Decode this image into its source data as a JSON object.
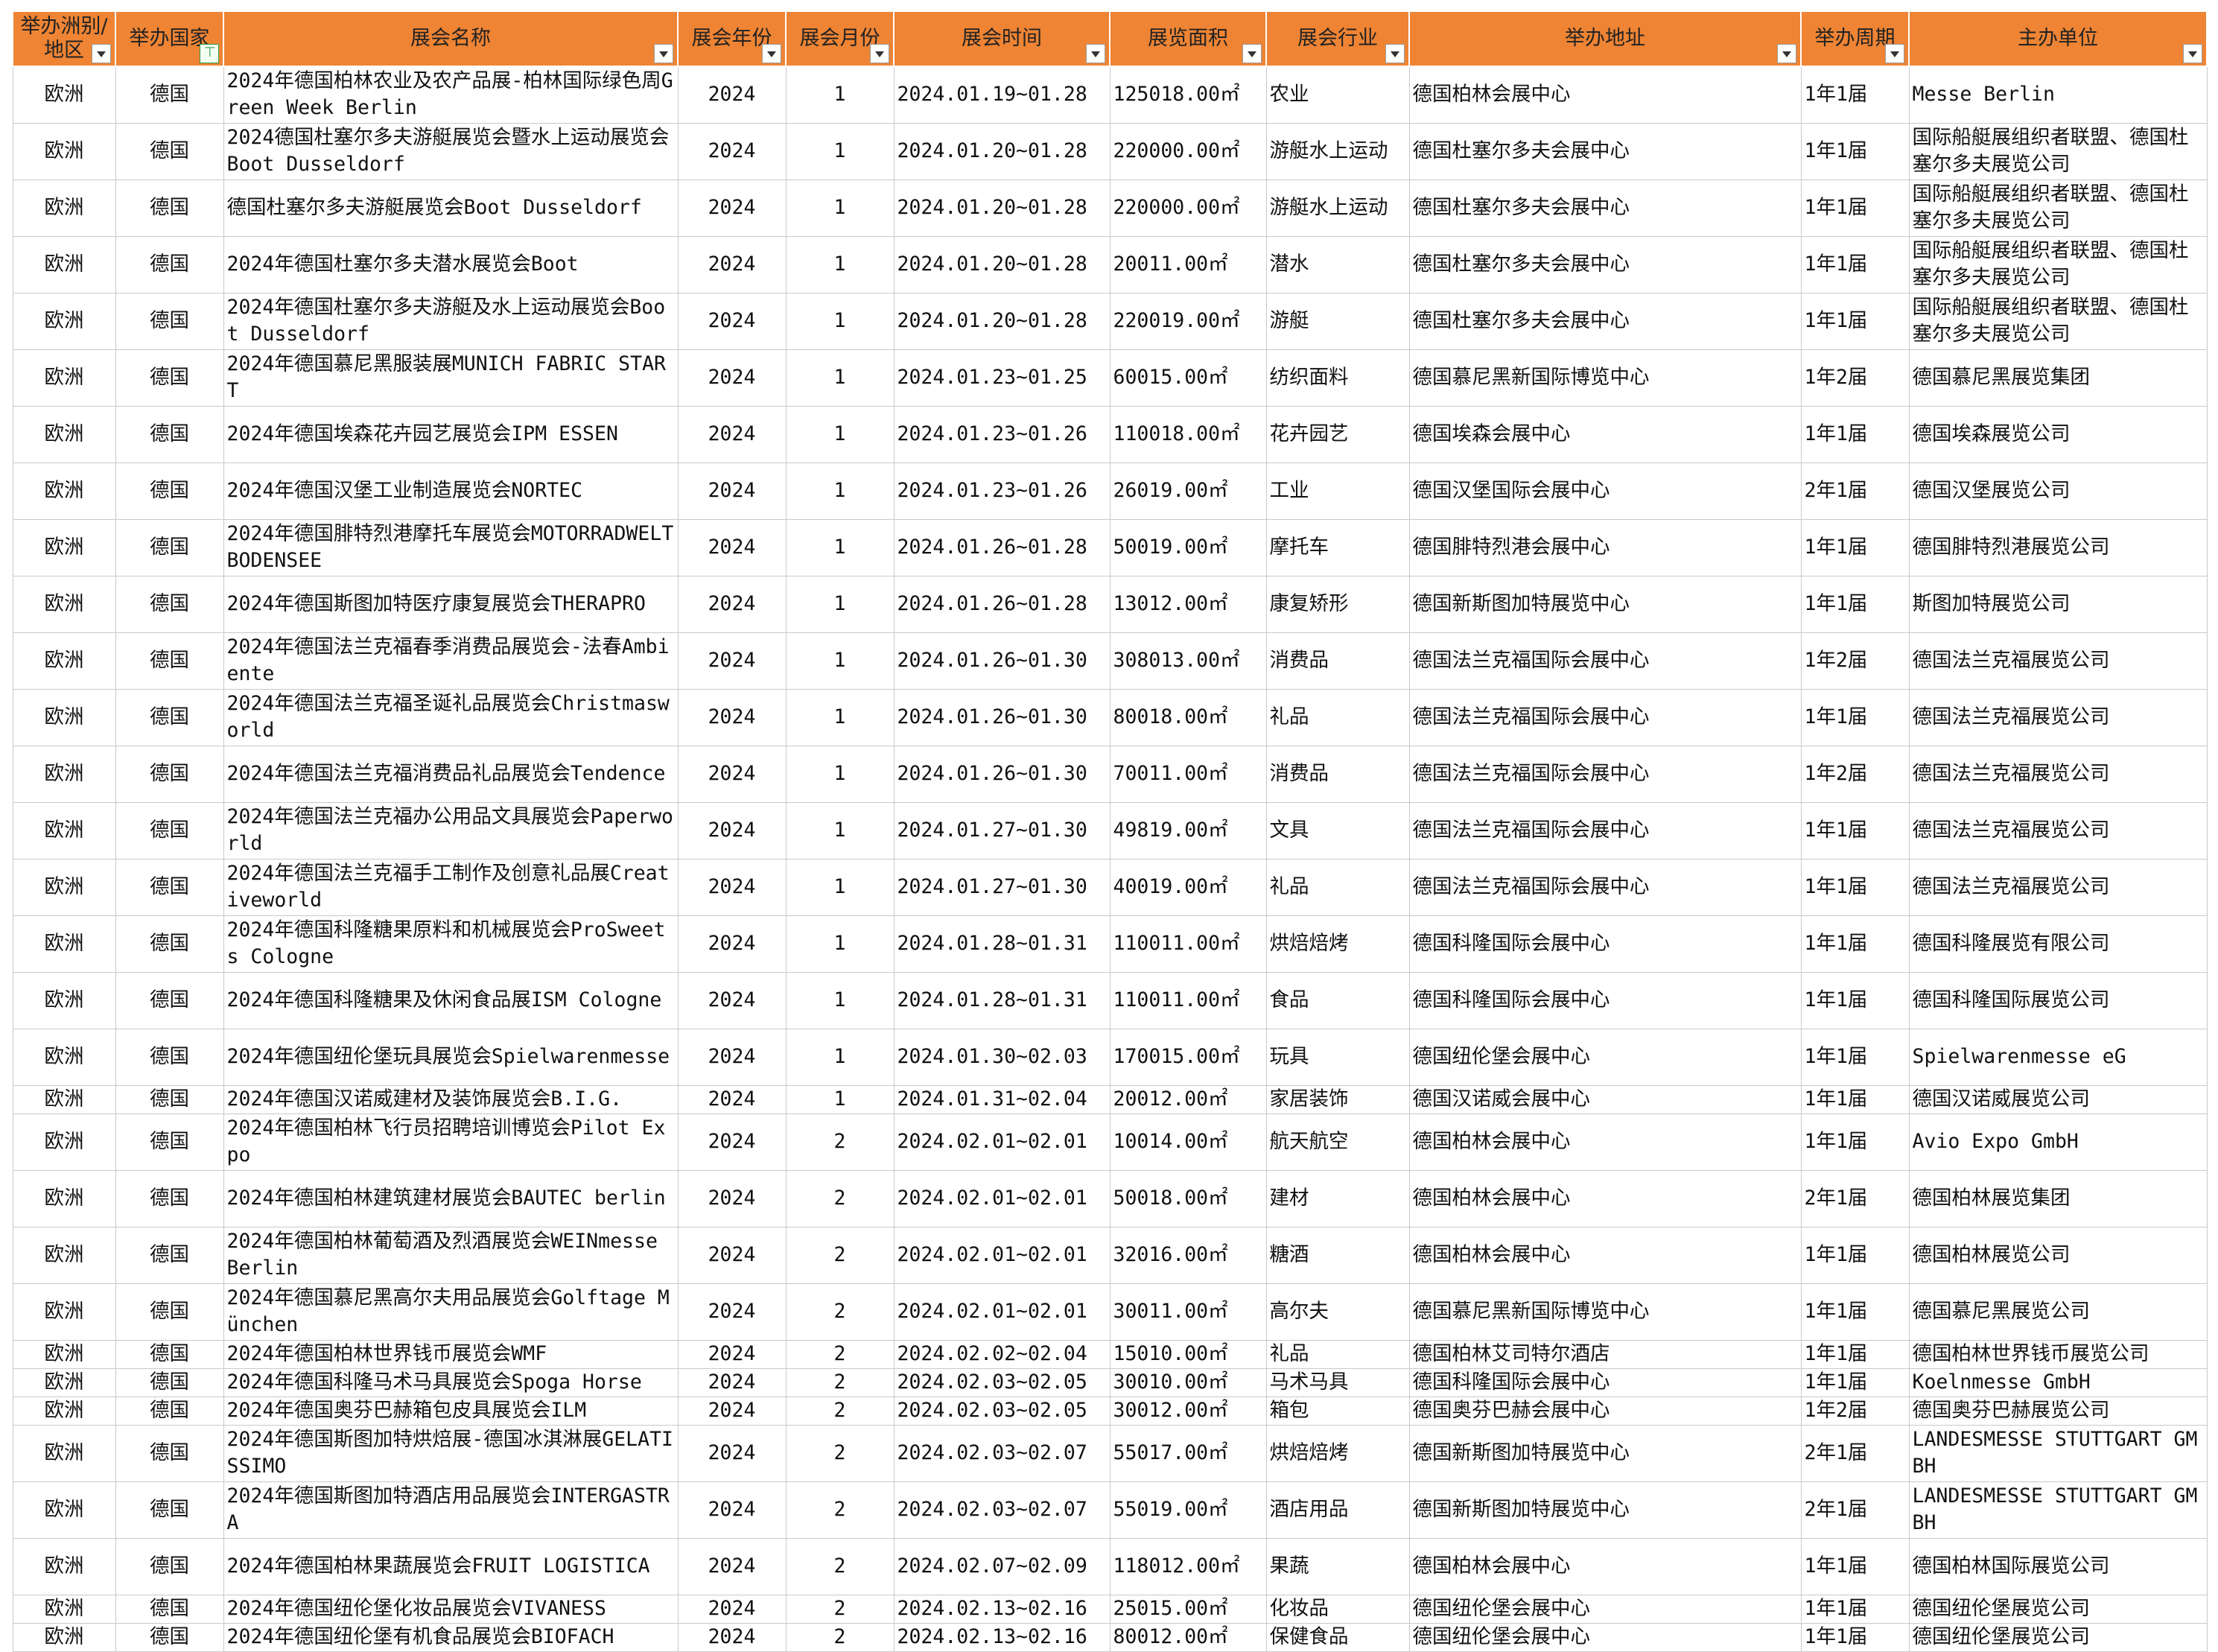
{
  "columns": [
    {
      "label": "举办洲别/地区",
      "filter_active": false
    },
    {
      "label": "举办国家",
      "filter_active": true
    },
    {
      "label": "展会名称",
      "filter_active": false
    },
    {
      "label": "展会年份",
      "filter_active": false
    },
    {
      "label": "展会月份",
      "filter_active": false
    },
    {
      "label": "展会时间",
      "filter_active": false
    },
    {
      "label": "展览面积",
      "filter_active": false
    },
    {
      "label": "展会行业",
      "filter_active": false
    },
    {
      "label": "举办地址",
      "filter_active": false
    },
    {
      "label": "举办周期",
      "filter_active": false
    },
    {
      "label": "主办单位",
      "filter_active": false
    }
  ],
  "rows": [
    [
      "欧洲",
      "德国",
      "2024年德国柏林农业及农产品展-柏林国际绿色周Green Week Berlin",
      "2024",
      "1",
      "2024.01.19~01.28",
      "125018.00㎡",
      "农业",
      "德国柏林会展中心",
      "1年1届",
      "Messe Berlin"
    ],
    [
      "欧洲",
      "德国",
      "2024德国杜塞尔多夫游艇展览会暨水上运动展览会Boot Dusseldorf",
      "2024",
      "1",
      "2024.01.20~01.28",
      "220000.00㎡",
      "游艇水上运动",
      "德国杜塞尔多夫会展中心",
      "1年1届",
      "国际船艇展组织者联盟、德国杜塞尔多夫展览公司"
    ],
    [
      "欧洲",
      "德国",
      "德国杜塞尔多夫游艇展览会Boot Dusseldorf",
      "2024",
      "1",
      "2024.01.20~01.28",
      "220000.00㎡",
      "游艇水上运动",
      "德国杜塞尔多夫会展中心",
      "1年1届",
      "国际船艇展组织者联盟、德国杜塞尔多夫展览公司"
    ],
    [
      "欧洲",
      "德国",
      "2024年德国杜塞尔多夫潜水展览会Boot",
      "2024",
      "1",
      "2024.01.20~01.28",
      "20011.00㎡",
      "潜水",
      "德国杜塞尔多夫会展中心",
      "1年1届",
      "国际船艇展组织者联盟、德国杜塞尔多夫展览公司"
    ],
    [
      "欧洲",
      "德国",
      "2024年德国杜塞尔多夫游艇及水上运动展览会Boot Dusseldorf",
      "2024",
      "1",
      "2024.01.20~01.28",
      "220019.00㎡",
      "游艇",
      "德国杜塞尔多夫会展中心",
      "1年1届",
      "国际船艇展组织者联盟、德国杜塞尔多夫展览公司"
    ],
    [
      "欧洲",
      "德国",
      "2024年德国慕尼黑服装展MUNICH FABRIC START",
      "2024",
      "1",
      "2024.01.23~01.25",
      "60015.00㎡",
      "纺织面料",
      "德国慕尼黑新国际博览中心",
      "1年2届",
      "德国慕尼黑展览集团"
    ],
    [
      "欧洲",
      "德国",
      "2024年德国埃森花卉园艺展览会IPM ESSEN",
      "2024",
      "1",
      "2024.01.23~01.26",
      "110018.00㎡",
      "花卉园艺",
      "德国埃森会展中心",
      "1年1届",
      "德国埃森展览公司"
    ],
    [
      "欧洲",
      "德国",
      "2024年德国汉堡工业制造展览会NORTEC",
      "2024",
      "1",
      "2024.01.23~01.26",
      "26019.00㎡",
      "工业",
      "德国汉堡国际会展中心",
      "2年1届",
      "德国汉堡展览公司"
    ],
    [
      "欧洲",
      "德国",
      "2024年德国腓特烈港摩托车展览会MOTORRADWELT BODENSEE",
      "2024",
      "1",
      "2024.01.26~01.28",
      "50019.00㎡",
      "摩托车",
      "德国腓特烈港会展中心",
      "1年1届",
      "德国腓特烈港展览公司"
    ],
    [
      "欧洲",
      "德国",
      "2024年德国斯图加特医疗康复展览会THERAPRO",
      "2024",
      "1",
      "2024.01.26~01.28",
      "13012.00㎡",
      "康复矫形",
      "德国新斯图加特展览中心",
      "1年1届",
      "斯图加特展览公司"
    ],
    [
      "欧洲",
      "德国",
      "2024年德国法兰克福春季消费品展览会-法春Ambiente",
      "2024",
      "1",
      "2024.01.26~01.30",
      "308013.00㎡",
      "消费品",
      "德国法兰克福国际会展中心",
      "1年2届",
      "德国法兰克福展览公司"
    ],
    [
      "欧洲",
      "德国",
      "2024年德国法兰克福圣诞礼品展览会Christmasworld",
      "2024",
      "1",
      "2024.01.26~01.30",
      "80018.00㎡",
      "礼品",
      "德国法兰克福国际会展中心",
      "1年1届",
      "德国法兰克福展览公司"
    ],
    [
      "欧洲",
      "德国",
      "2024年德国法兰克福消费品礼品展览会Tendence",
      "2024",
      "1",
      "2024.01.26~01.30",
      "70011.00㎡",
      "消费品",
      "德国法兰克福国际会展中心",
      "1年2届",
      "德国法兰克福展览公司"
    ],
    [
      "欧洲",
      "德国",
      "2024年德国法兰克福办公用品文具展览会Paperworld",
      "2024",
      "1",
      "2024.01.27~01.30",
      "49819.00㎡",
      "文具",
      "德国法兰克福国际会展中心",
      "1年1届",
      "德国法兰克福展览公司"
    ],
    [
      "欧洲",
      "德国",
      "2024年德国法兰克福手工制作及创意礼品展Creativeworld",
      "2024",
      "1",
      "2024.01.27~01.30",
      "40019.00㎡",
      "礼品",
      "德国法兰克福国际会展中心",
      "1年1届",
      "德国法兰克福展览公司"
    ],
    [
      "欧洲",
      "德国",
      "2024年德国科隆糖果原料和机械展览会ProSweets Cologne",
      "2024",
      "1",
      "2024.01.28~01.31",
      "110011.00㎡",
      "烘焙焙烤",
      "德国科隆国际会展中心",
      "1年1届",
      "德国科隆展览有限公司"
    ],
    [
      "欧洲",
      "德国",
      "2024年德国科隆糖果及休闲食品展ISM Cologne",
      "2024",
      "1",
      "2024.01.28~01.31",
      "110011.00㎡",
      "食品",
      "德国科隆国际会展中心",
      "1年1届",
      "德国科隆国际展览公司"
    ],
    [
      "欧洲",
      "德国",
      "2024年德国纽伦堡玩具展览会Spielwarenmesse",
      "2024",
      "1",
      "2024.01.30~02.03",
      "170015.00㎡",
      "玩具",
      "德国纽伦堡会展中心",
      "1年1届",
      "Spielwarenmesse eG"
    ],
    [
      "欧洲",
      "德国",
      "2024年德国汉诺威建材及装饰展览会B.I.G.",
      "2024",
      "1",
      "2024.01.31~02.04",
      "20012.00㎡",
      "家居装饰",
      "德国汉诺威会展中心",
      "1年1届",
      "德国汉诺威展览公司"
    ],
    [
      "欧洲",
      "德国",
      "2024年德国柏林飞行员招聘培训博览会Pilot Expo",
      "2024",
      "2",
      "2024.02.01~02.01",
      "10014.00㎡",
      "航天航空",
      "德国柏林会展中心",
      "1年1届",
      "Avio Expo GmbH"
    ],
    [
      "欧洲",
      "德国",
      "2024年德国柏林建筑建材展览会BAUTEC berlin",
      "2024",
      "2",
      "2024.02.01~02.01",
      "50018.00㎡",
      "建材",
      "德国柏林会展中心",
      "2年1届",
      "德国柏林展览集团"
    ],
    [
      "欧洲",
      "德国",
      "2024年德国柏林葡萄酒及烈酒展览会WEINmesse Berlin",
      "2024",
      "2",
      "2024.02.01~02.01",
      "32016.00㎡",
      "糖酒",
      "德国柏林会展中心",
      "1年1届",
      "德国柏林展览公司"
    ],
    [
      "欧洲",
      "德国",
      "2024年德国慕尼黑高尔夫用品展览会Golftage München",
      "2024",
      "2",
      "2024.02.01~02.01",
      "30011.00㎡",
      "高尔夫",
      "德国慕尼黑新国际博览中心",
      "1年1届",
      "德国慕尼黑展览公司"
    ],
    [
      "欧洲",
      "德国",
      "2024年德国柏林世界钱币展览会WMF",
      "2024",
      "2",
      "2024.02.02~02.04",
      "15010.00㎡",
      "礼品",
      "德国柏林艾司特尔酒店",
      "1年1届",
      "德国柏林世界钱币展览公司"
    ],
    [
      "欧洲",
      "德国",
      "2024年德国科隆马术马具展览会Spoga Horse",
      "2024",
      "2",
      "2024.02.03~02.05",
      "30010.00㎡",
      "马术马具",
      "德国科隆国际会展中心",
      "1年1届",
      "Koelnmesse GmbH"
    ],
    [
      "欧洲",
      "德国",
      "2024年德国奥芬巴赫箱包皮具展览会ILM",
      "2024",
      "2",
      "2024.02.03~02.05",
      "30012.00㎡",
      "箱包",
      "德国奥芬巴赫会展中心",
      "1年2届",
      "德国奥芬巴赫展览公司"
    ],
    [
      "欧洲",
      "德国",
      "2024年德国斯图加特烘焙展-德国冰淇淋展GELATISSIMO",
      "2024",
      "2",
      "2024.02.03~02.07",
      "55017.00㎡",
      "烘焙焙烤",
      "德国新斯图加特展览中心",
      "2年1届",
      "LANDESMESSE STUTTGART GMBH"
    ],
    [
      "欧洲",
      "德国",
      "2024年德国斯图加特酒店用品展览会INTERGASTRA",
      "2024",
      "2",
      "2024.02.03~02.07",
      "55019.00㎡",
      "酒店用品",
      "德国新斯图加特展览中心",
      "2年1届",
      "LANDESMESSE STUTTGART GMBH"
    ],
    [
      "欧洲",
      "德国",
      "2024年德国柏林果蔬展览会FRUIT LOGISTICA",
      "2024",
      "2",
      "2024.02.07~02.09",
      "118012.00㎡",
      "果蔬",
      "德国柏林会展中心",
      "1年1届",
      "德国柏林国际展览公司"
    ],
    [
      "欧洲",
      "德国",
      "2024年德国纽伦堡化妆品展览会VIVANESS",
      "2024",
      "2",
      "2024.02.13~02.16",
      "25015.00㎡",
      "化妆品",
      "德国纽伦堡会展中心",
      "1年1届",
      "德国纽伦堡展览公司"
    ],
    [
      "欧洲",
      "德国",
      "2024年德国纽伦堡有机食品展览会BIOFACH",
      "2024",
      "2",
      "2024.02.13~02.16",
      "80012.00㎡",
      "保健食品",
      "德国纽伦堡会展中心",
      "1年1届",
      "德国纽伦堡展览公司"
    ]
  ]
}
